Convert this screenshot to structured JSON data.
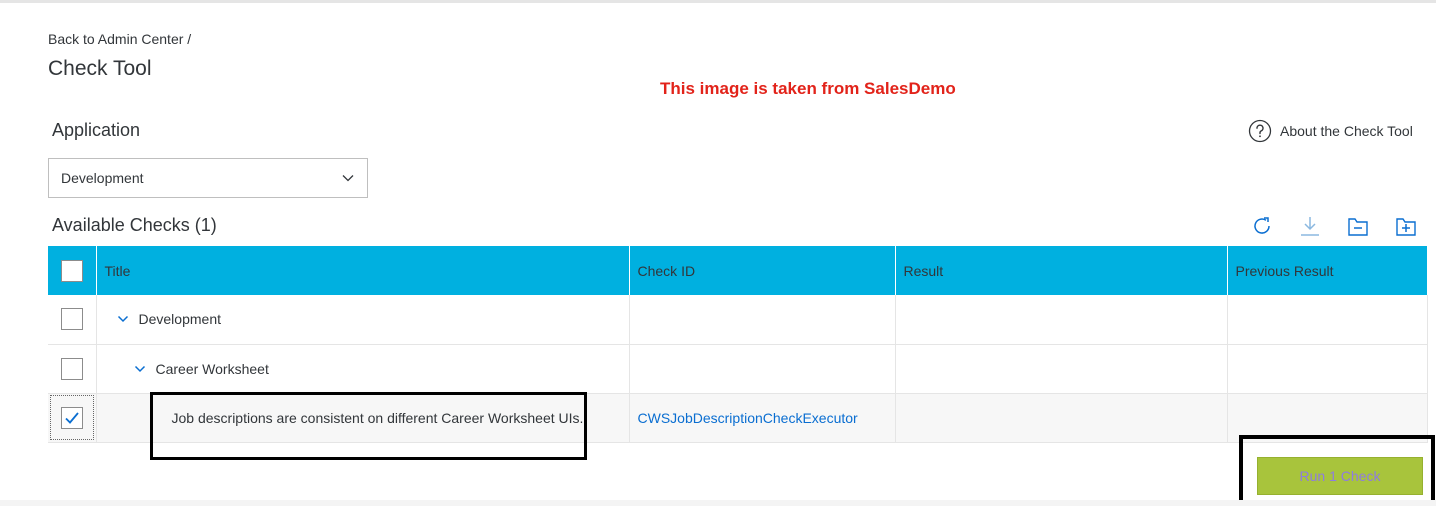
{
  "header": {
    "breadcrumb_link": "Back to Admin Center",
    "breadcrumb_sep": "/",
    "title": "Check Tool",
    "watermark": "This image is taken from SalesDemo"
  },
  "application": {
    "label": "Application",
    "selected": "Development",
    "about_link": "About the Check Tool"
  },
  "checks": {
    "label": "Available Checks (1)",
    "toolbar_icons": [
      "refresh-icon",
      "download-icon",
      "collapse-all-icon",
      "expand-all-icon"
    ],
    "columns": [
      "Title",
      "Check ID",
      "Result",
      "Previous Result"
    ],
    "rows": [
      {
        "title": "Development",
        "check_id": "",
        "result": "",
        "previous": "",
        "checked": false,
        "level": 1
      },
      {
        "title": "Career Worksheet",
        "check_id": "",
        "result": "",
        "previous": "",
        "checked": false,
        "level": 2
      },
      {
        "title": "Job descriptions are consistent on different Career Worksheet UIs.",
        "check_id": "CWSJobDescriptionCheckExecutor",
        "result": "",
        "previous": "",
        "checked": true,
        "level": 3
      }
    ]
  },
  "actions": {
    "run_label": "Run 1 Check"
  },
  "colors": {
    "header_bg": "#00b0e0",
    "run_button_bg": "#a8c43c",
    "link": "#0a6ed1",
    "watermark": "#e2231a"
  }
}
